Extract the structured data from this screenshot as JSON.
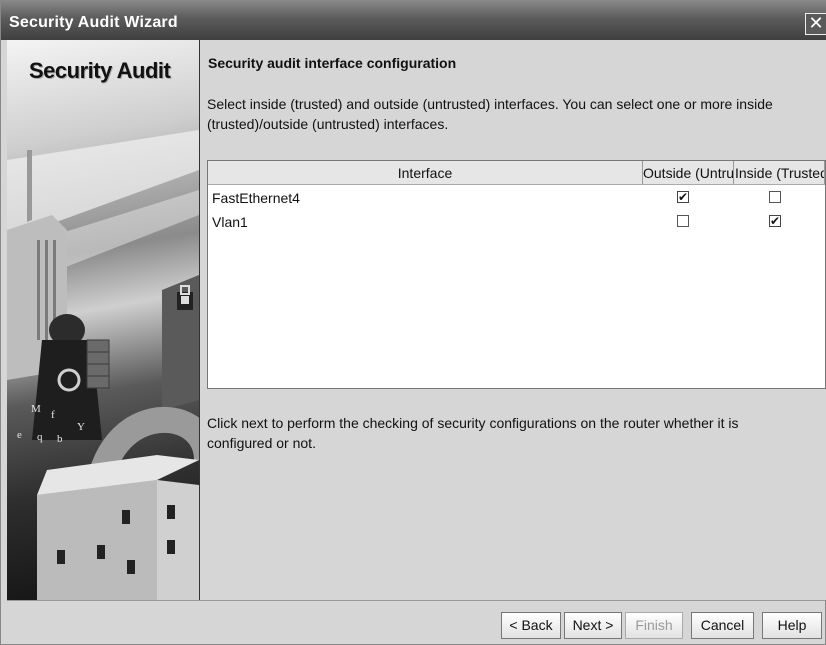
{
  "window": {
    "title": "Security Audit Wizard",
    "close_glyph": "✕"
  },
  "sidebar": {
    "title": "Security Audit"
  },
  "main": {
    "heading": "Security audit interface configuration",
    "description": "Select inside (trusted) and outside (untrusted) interfaces. You can select one or more inside (trusted)/outside (untrusted) interfaces.",
    "table": {
      "columns": [
        "Interface",
        "Outside (Untrusted)",
        "Inside (Trusted)"
      ],
      "rows": [
        {
          "interface": "FastEthernet4",
          "outside": true,
          "inside": false
        },
        {
          "interface": "Vlan1",
          "outside": false,
          "inside": true
        }
      ]
    },
    "note": "Click next to perform the checking of security configurations on the router whether it is configured or not."
  },
  "buttons": {
    "back": "< Back",
    "next": "Next >",
    "finish": "Finish",
    "cancel": "Cancel",
    "help": "Help"
  },
  "checkbox": {
    "checked_glyph": "✔",
    "unchecked_glyph": ""
  }
}
